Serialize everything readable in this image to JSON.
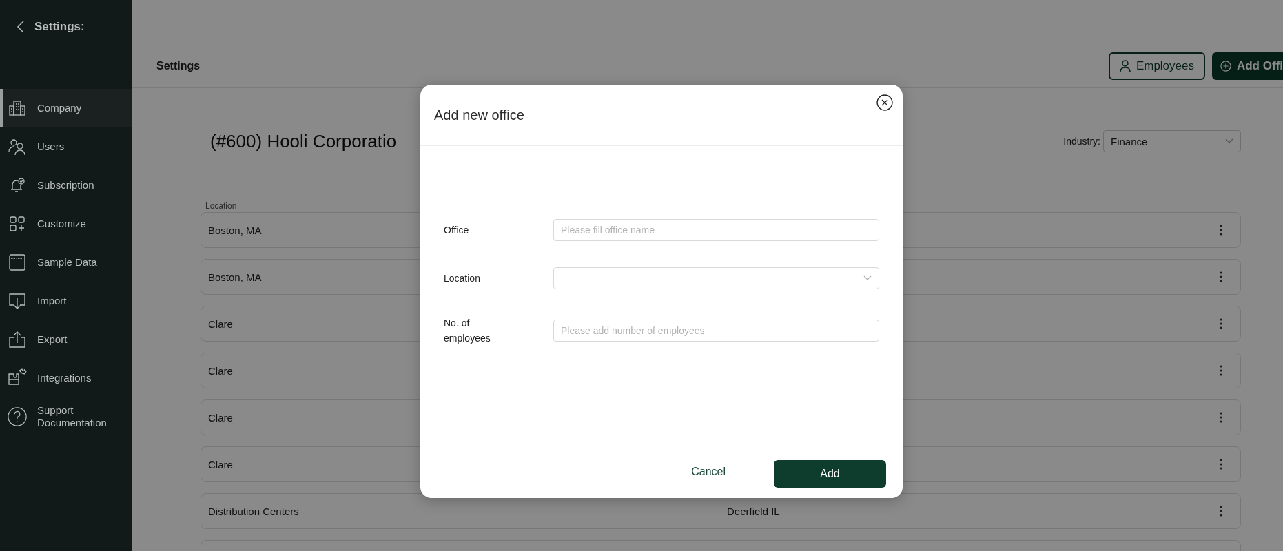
{
  "sidebar": {
    "title": "Settings:",
    "items": [
      {
        "label": "Company",
        "selected": true
      },
      {
        "label": "Users",
        "selected": false
      },
      {
        "label": "Subscription",
        "selected": false
      },
      {
        "label": "Customize",
        "selected": false
      },
      {
        "label": "Sample Data",
        "selected": false
      },
      {
        "label": "Import",
        "selected": false
      },
      {
        "label": "Export",
        "selected": false
      },
      {
        "label": "Integrations",
        "selected": false
      },
      {
        "label": "Support Documentation",
        "selected": false
      }
    ]
  },
  "header": {
    "title": "Settings",
    "buttons": [
      "Employees",
      "Add Offi"
    ]
  },
  "company": {
    "title": "(#600) Hooli Corporatio",
    "industry_label": "Industry:",
    "industry_value": "Finance"
  },
  "table": {
    "columns": [
      "Location"
    ],
    "rows": [
      {
        "location": "Boston, MA"
      },
      {
        "location": "Boston, MA"
      },
      {
        "location": "Clare"
      },
      {
        "location": "Clare"
      },
      {
        "location": "Clare"
      },
      {
        "location": "Clare"
      },
      {
        "location": "Distribution Centers",
        "column_2": "Deerfield IL"
      },
      {}
    ]
  },
  "modal": {
    "title": "Add new office",
    "fields": [
      {
        "kind": "text",
        "label": "Office",
        "placeholder": "Please fill office name"
      },
      {
        "kind": "select",
        "label": "Location"
      },
      {
        "kind": "text",
        "label": "No. of employees",
        "placeholder": "Please add number of employees"
      }
    ],
    "cancel": "Cancel",
    "submit": "Add"
  }
}
